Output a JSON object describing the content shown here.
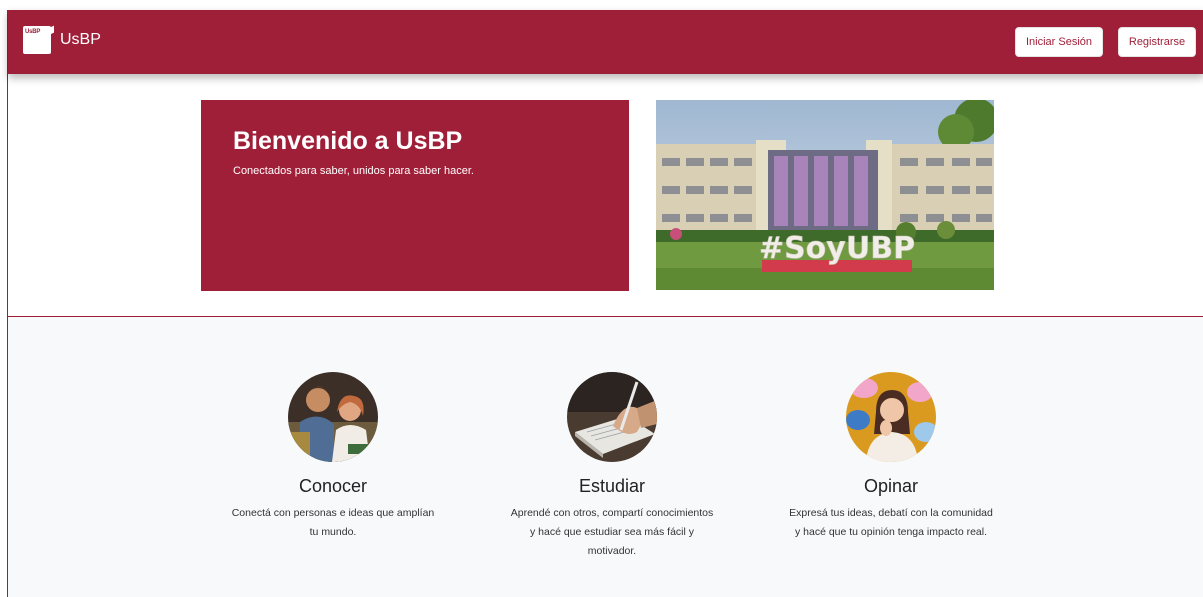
{
  "navbar": {
    "logo_text": "UsBP",
    "brand": "UsBP",
    "login_label": "Iniciar Sesión",
    "register_label": "Registrarse"
  },
  "hero": {
    "title": "Bienvenido a UsBP",
    "subtitle": "Conectados para saber, unidos para saber hacer.",
    "photo_sign": "#SoyUBP"
  },
  "features": [
    {
      "title": "Conocer",
      "text": "Conectá con personas e ideas que amplían tu mundo.",
      "icon": "students-photo"
    },
    {
      "title": "Estudiar",
      "text": "Aprendé con otros, compartí conocimientos y hacé que estudiar sea más fácil y motivador.",
      "icon": "writing-notebook-photo"
    },
    {
      "title": "Opinar",
      "text": "Expresá tus ideas, debatí con la comunidad y hacé que tu opinión tenga impacto real.",
      "icon": "thinking-woman-photo"
    }
  ],
  "colors": {
    "brand": "#a01f38",
    "background": "#f8f9fa"
  }
}
